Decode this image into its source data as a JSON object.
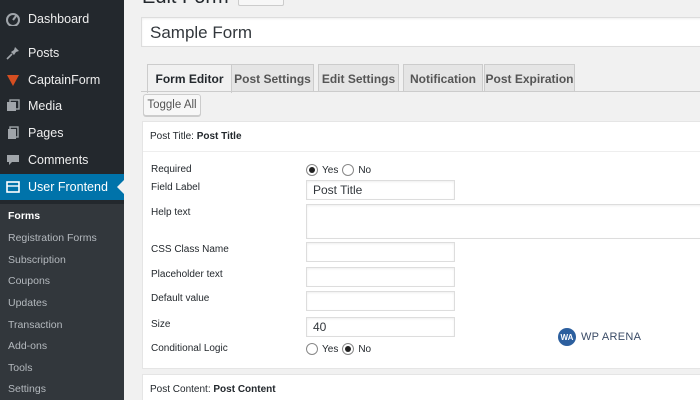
{
  "sidebar": {
    "items": [
      {
        "label": "Dashboard",
        "icon": "dashboard-icon"
      },
      {
        "label": "Posts",
        "icon": "pin-icon"
      },
      {
        "label": "CaptainForm",
        "icon": "captainform-icon"
      },
      {
        "label": "Media",
        "icon": "media-icon"
      },
      {
        "label": "Pages",
        "icon": "pages-icon"
      },
      {
        "label": "Comments",
        "icon": "comments-icon"
      },
      {
        "label": "User Frontend",
        "icon": "user-frontend-icon"
      }
    ],
    "submenu": [
      "Forms",
      "Registration Forms",
      "Subscription",
      "Coupons",
      "Updates",
      "Transaction",
      "Add-ons",
      "Tools",
      "Settings"
    ],
    "accent": "#0073aa"
  },
  "page": {
    "title": "Edit Form"
  },
  "form_name": "Sample Form",
  "tabs": [
    "Form Editor",
    "Post Settings",
    "Edit Settings",
    "Notification",
    "Post Expiration"
  ],
  "toggle_all": "Toggle All",
  "field": {
    "header_prefix": "Post Title:",
    "header_name": "Post Title",
    "rows": {
      "required": "Required",
      "field_label": "Field Label",
      "help_text": "Help text",
      "css_class": "CSS Class Name",
      "placeholder": "Placeholder text",
      "default": "Default value",
      "size": "Size",
      "conditional": "Conditional Logic"
    },
    "required_yes": "Yes",
    "required_no": "No",
    "field_label_value": "Post Title",
    "size_value": "40",
    "cond_yes": "Yes",
    "cond_no": "No"
  },
  "watermark": {
    "logo": "WA",
    "text": "WP ARENA"
  },
  "field2": {
    "header_prefix": "Post Content:",
    "header_name": "Post Content"
  }
}
